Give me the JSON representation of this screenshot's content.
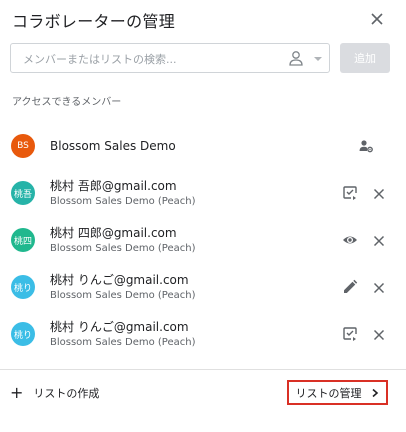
{
  "dialog": {
    "title": "コラボレーターの管理"
  },
  "search": {
    "placeholder": "メンバーまたはリストの検索...",
    "add_label": "追加"
  },
  "section_label": "アクセスできるメンバー",
  "members": [
    {
      "avatar_text": "BS",
      "avatar_color": "#e8590c",
      "name": "Blossom Sales Demo",
      "sub": "",
      "role_icon": "manage-members-icon"
    },
    {
      "avatar_text": "桃吾",
      "avatar_color": "#26b3a8",
      "name": "桃村 吾郎@gmail.com",
      "sub": "Blossom Sales Demo (Peach)",
      "role_icon": "review-icon"
    },
    {
      "avatar_text": "桃四",
      "avatar_color": "#20b88e",
      "name": "桃村 四郎@gmail.com",
      "sub": "Blossom Sales Demo (Peach)",
      "role_icon": "view-icon"
    },
    {
      "avatar_text": "桃り",
      "avatar_color": "#3bbde6",
      "name": "桃村 りんご@gmail.com",
      "sub": "Blossom Sales Demo (Peach)",
      "role_icon": "edit-icon"
    },
    {
      "avatar_text": "桃り",
      "avatar_color": "#3bbde6",
      "name": "桃村 りんご@gmail.com",
      "sub": "Blossom Sales Demo (Peach)",
      "role_icon": "review-icon"
    }
  ],
  "footer": {
    "create_list_label": "リストの作成",
    "manage_list_label": "リストの管理"
  },
  "colors": {
    "highlight_border": "#d93025",
    "disabled_button": "#dadce0"
  }
}
